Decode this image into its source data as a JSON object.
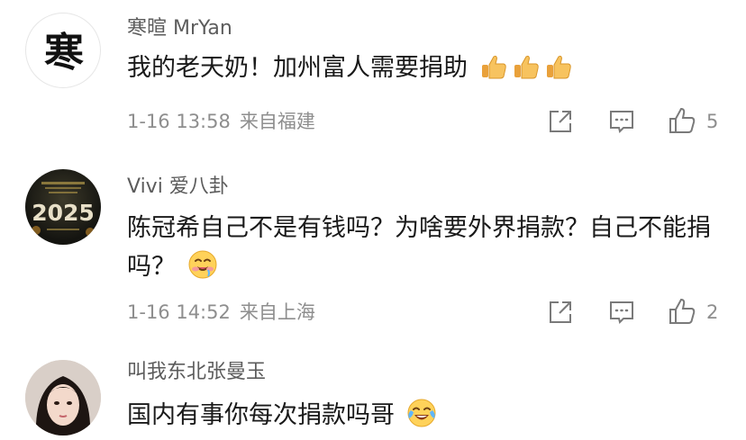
{
  "comments": [
    {
      "username": "寒暄 MrYan",
      "avatar_text": "寒",
      "text": "我的老天奶！加州富人需要捐助",
      "emoji": [
        "thumbs-up",
        "thumbs-up",
        "thumbs-up"
      ],
      "time": "1-16 13:58",
      "location": "来自福建",
      "likes": "5"
    },
    {
      "username": "Vivi 爱八卦",
      "avatar_text": "2025",
      "text": "陈冠希自己不是有钱吗？为啥要外界捐款？自己不能捐吗？",
      "emoji": [
        "drooling-face"
      ],
      "time": "1-16 14:52",
      "location": "来自上海",
      "likes": "2"
    },
    {
      "username": "叫我东北张曼玉",
      "text": "国内有事你每次捐款吗哥",
      "emoji": [
        "tears-of-joy"
      ]
    }
  ]
}
